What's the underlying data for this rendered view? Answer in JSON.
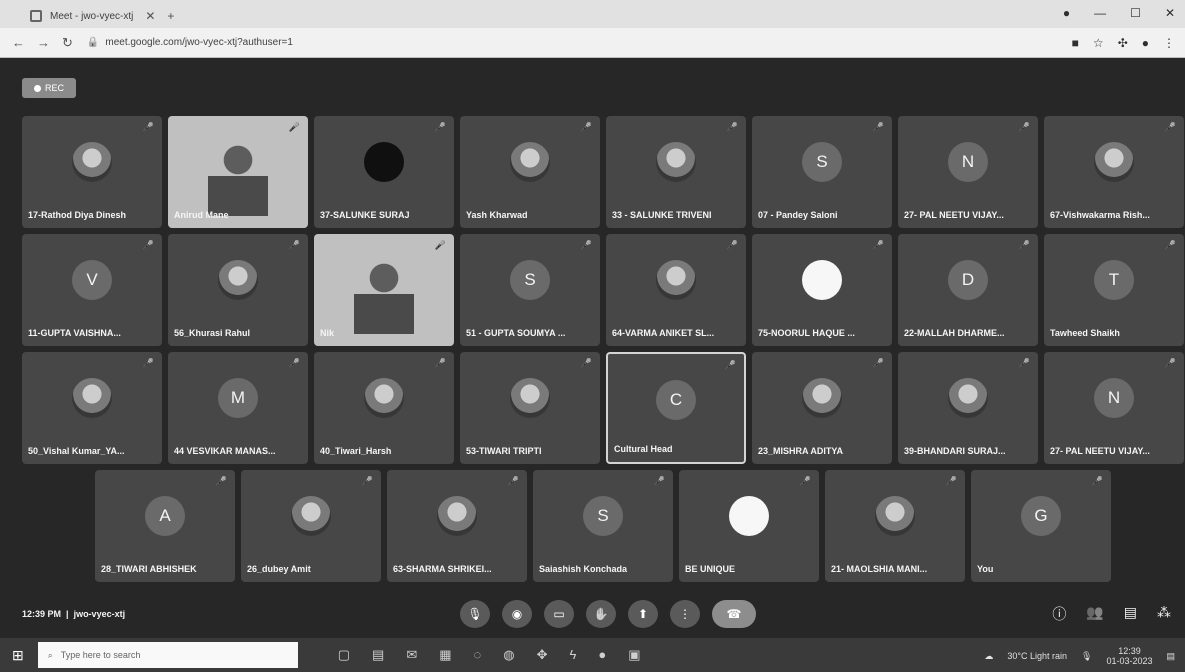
{
  "browser": {
    "tab_title": "Meet - jwo-vyec-xtj",
    "url": "meet.google.com/jwo-vyec-xtj?authuser=1"
  },
  "meet": {
    "rec_label": "REC",
    "meeting_time": "12:39 PM",
    "meeting_code": "jwo-vyec-xtj",
    "participants": [
      {
        "name": "17-Rathod Diya Dinesh",
        "initial": "",
        "kind": "photo"
      },
      {
        "name": "Anirud Mane",
        "initial": "",
        "kind": "video"
      },
      {
        "name": "37-SALUNKE SURAJ",
        "initial": "",
        "kind": "dark"
      },
      {
        "name": "Yash Kharwad",
        "initial": "",
        "kind": "photo"
      },
      {
        "name": "33 - SALUNKE TRIVENI",
        "initial": "",
        "kind": "photo"
      },
      {
        "name": "07 - Pandey Saloni",
        "initial": "S",
        "kind": "letter"
      },
      {
        "name": "27- PAL NEETU VIJAY...",
        "initial": "N",
        "kind": "letter"
      },
      {
        "name": "67-Vishwakarma Rish...",
        "initial": "",
        "kind": "photo"
      },
      {
        "name": "11-GUPTA VAISHNA...",
        "initial": "V",
        "kind": "letter"
      },
      {
        "name": "56_Khurasi Rahul",
        "initial": "",
        "kind": "photo"
      },
      {
        "name": "Nik",
        "initial": "",
        "kind": "video"
      },
      {
        "name": "51 - GUPTA SOUMYA ...",
        "initial": "S",
        "kind": "letter"
      },
      {
        "name": "64-VARMA ANIKET SL...",
        "initial": "",
        "kind": "photo"
      },
      {
        "name": "75-NOORUL HAQUE ...",
        "initial": "",
        "kind": "white"
      },
      {
        "name": "22-MALLAH DHARME...",
        "initial": "D",
        "kind": "letter"
      },
      {
        "name": "Tawheed Shaikh",
        "initial": "T",
        "kind": "letter"
      },
      {
        "name": "50_Vishal Kumar_YA...",
        "initial": "",
        "kind": "photo"
      },
      {
        "name": "44 VESVIKAR MANAS...",
        "initial": "M",
        "kind": "letter"
      },
      {
        "name": "40_Tiwari_Harsh",
        "initial": "",
        "kind": "photo"
      },
      {
        "name": "53-TIWARI TRIPTI",
        "initial": "",
        "kind": "photo"
      },
      {
        "name": "Cultural Head",
        "initial": "C",
        "kind": "letter"
      },
      {
        "name": "23_MISHRA ADITYA",
        "initial": "",
        "kind": "photo"
      },
      {
        "name": "39-BHANDARI SURAJ...",
        "initial": "",
        "kind": "photo"
      },
      {
        "name": "27- PAL NEETU VIJAY...",
        "initial": "N",
        "kind": "letter"
      },
      {
        "name": "28_TIWARI ABHISHEK",
        "initial": "A",
        "kind": "letter"
      },
      {
        "name": "26_dubey Amit",
        "initial": "",
        "kind": "photo"
      },
      {
        "name": "63-SHARMA SHRIKEI...",
        "initial": "",
        "kind": "photo"
      },
      {
        "name": "Saiashish Konchada",
        "initial": "S",
        "kind": "letter"
      },
      {
        "name": "BE UNIQUE",
        "initial": "",
        "kind": "white"
      },
      {
        "name": "21- MAOLSHIA MANI...",
        "initial": "",
        "kind": "photo"
      },
      {
        "name": "You",
        "initial": "G",
        "kind": "letter"
      }
    ]
  },
  "taskbar": {
    "search_placeholder": "Type here to search",
    "weather": "30°C  Light rain",
    "time": "12:39",
    "date": "01-03-2023"
  }
}
